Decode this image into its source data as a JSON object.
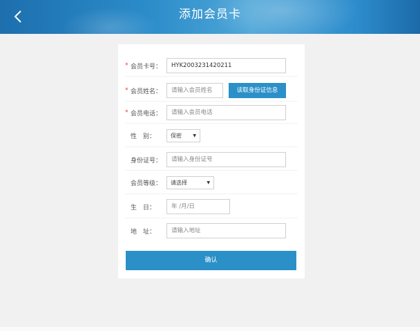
{
  "header": {
    "title": "添加会员卡",
    "back_icon": "chevron-left-icon"
  },
  "form": {
    "card_no": {
      "label": "会员卡号：",
      "required": "*",
      "value": "HYK2003231420211"
    },
    "name": {
      "label": "会员姓名：",
      "required": "*",
      "placeholder": "请输入会员姓名",
      "read_button": "读取身份证信息"
    },
    "phone": {
      "label": "会员电话：",
      "required": "*",
      "placeholder": "请输入会员电话"
    },
    "gender": {
      "label": "性　别：",
      "selected": "保密"
    },
    "id_no": {
      "label": "身份证号：",
      "placeholder": "请输入身份证号"
    },
    "level": {
      "label": "会员等级：",
      "selected": "请选择"
    },
    "birthday": {
      "label": "生　日：",
      "placeholder": "年 /月/日"
    },
    "address": {
      "label": "地　址：",
      "placeholder": "请输入地址"
    }
  },
  "actions": {
    "confirm_label": "确认"
  },
  "colors": {
    "primary": "#2b90c8",
    "required": "#e23c3c",
    "header": "#2b8cc9"
  }
}
